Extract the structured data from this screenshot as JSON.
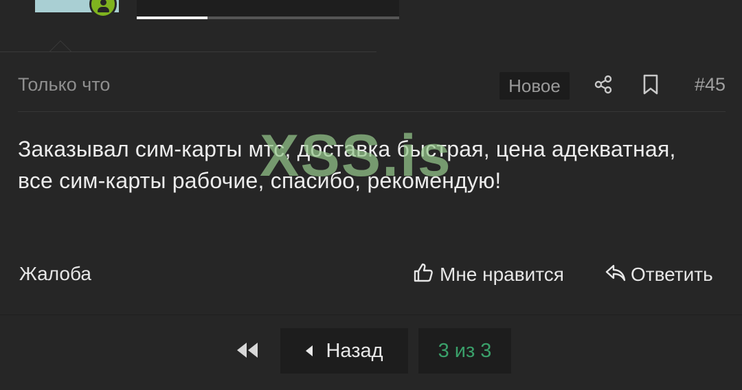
{
  "media": {
    "progress": 0.27
  },
  "post": {
    "time": "Только что",
    "new_badge": "Новое",
    "number": "#45",
    "body": "Заказывал сим-карты мтс, доставка быстрая, цена адекватная, все сим-карты рабочие, спасибо, рекомендую!",
    "watermark": "XSS.is"
  },
  "actions": {
    "report": "Жалоба",
    "like": "Мне нравится",
    "reply": "Ответить"
  },
  "pagination": {
    "prev": "Назад",
    "current": "3 из 3"
  },
  "icons": {
    "share": "share-icon",
    "bookmark": "bookmark-icon",
    "like": "thumbs-up-icon",
    "reply": "reply-arrow-icon",
    "first": "double-left-icon",
    "prev": "caret-left-icon",
    "avatar": "user-icon"
  },
  "colors": {
    "background": "#262626",
    "accent": "#3aa06a",
    "avatar_badge": "#7fb31f"
  }
}
